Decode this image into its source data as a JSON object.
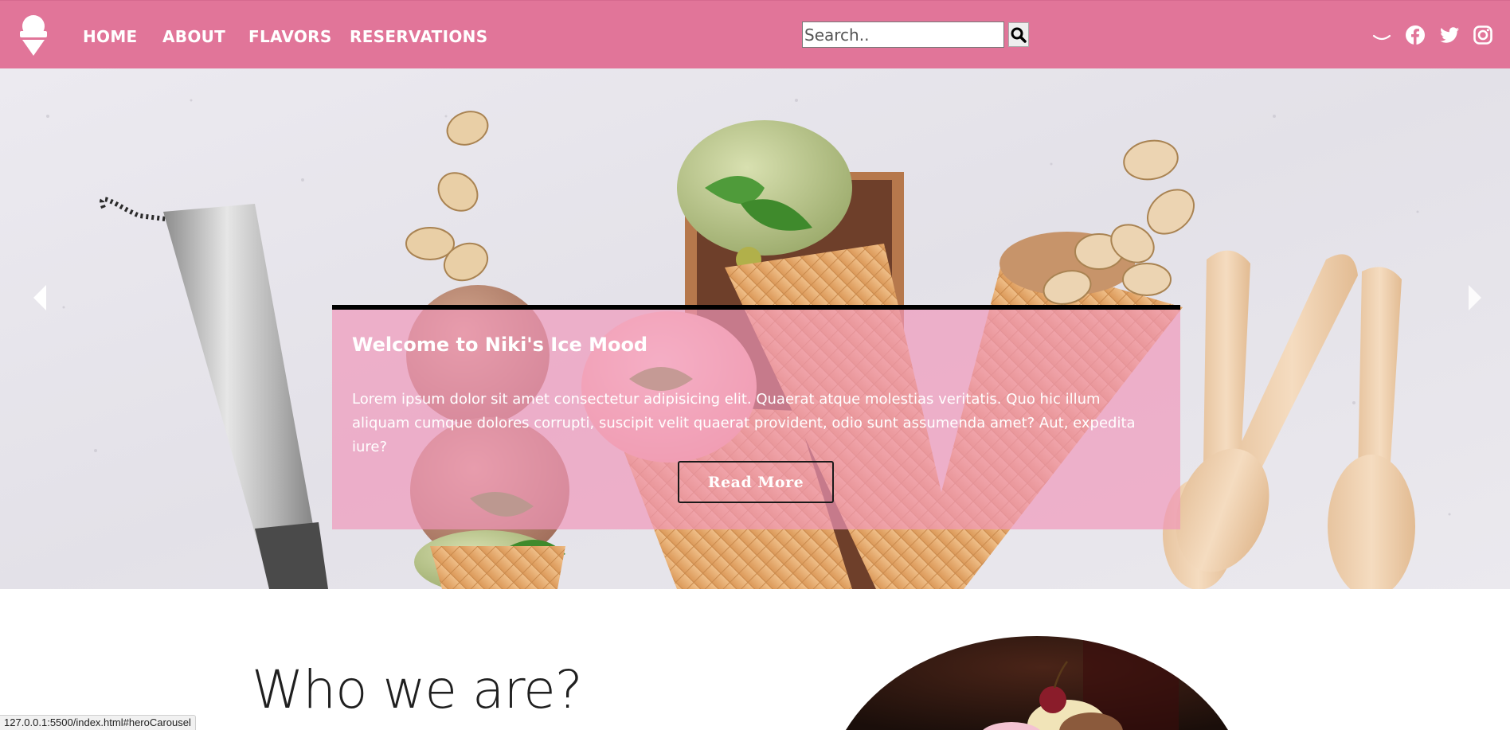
{
  "navbar": {
    "background": "#e17599",
    "links": [
      "HOME",
      "ABOUT",
      "FLAVORS",
      "RESERVATIONS"
    ],
    "search": {
      "placeholder": "Search.."
    },
    "icons": [
      "ice-cream-logo-icon",
      "search-icon",
      "moon-icon",
      "facebook-icon",
      "twitter-icon",
      "instagram-icon"
    ]
  },
  "hero": {
    "title": "Welcome to Niki's Ice Mood",
    "text": "Lorem ipsum dolor sit amet consectetur adipisicing elit. Quaerat atque molestias veritatis. Quo hic illum aliquam cumque dolores corrupti, suscipit velit quaerat provident, odio sunt assumenda amet? Aut, expedita iure?",
    "button": "Read More",
    "caption_color": "#f096b9"
  },
  "about": {
    "heading": "Who we are?"
  },
  "status": {
    "url": "127.0.0.1:5500/index.html#heroCarousel"
  }
}
